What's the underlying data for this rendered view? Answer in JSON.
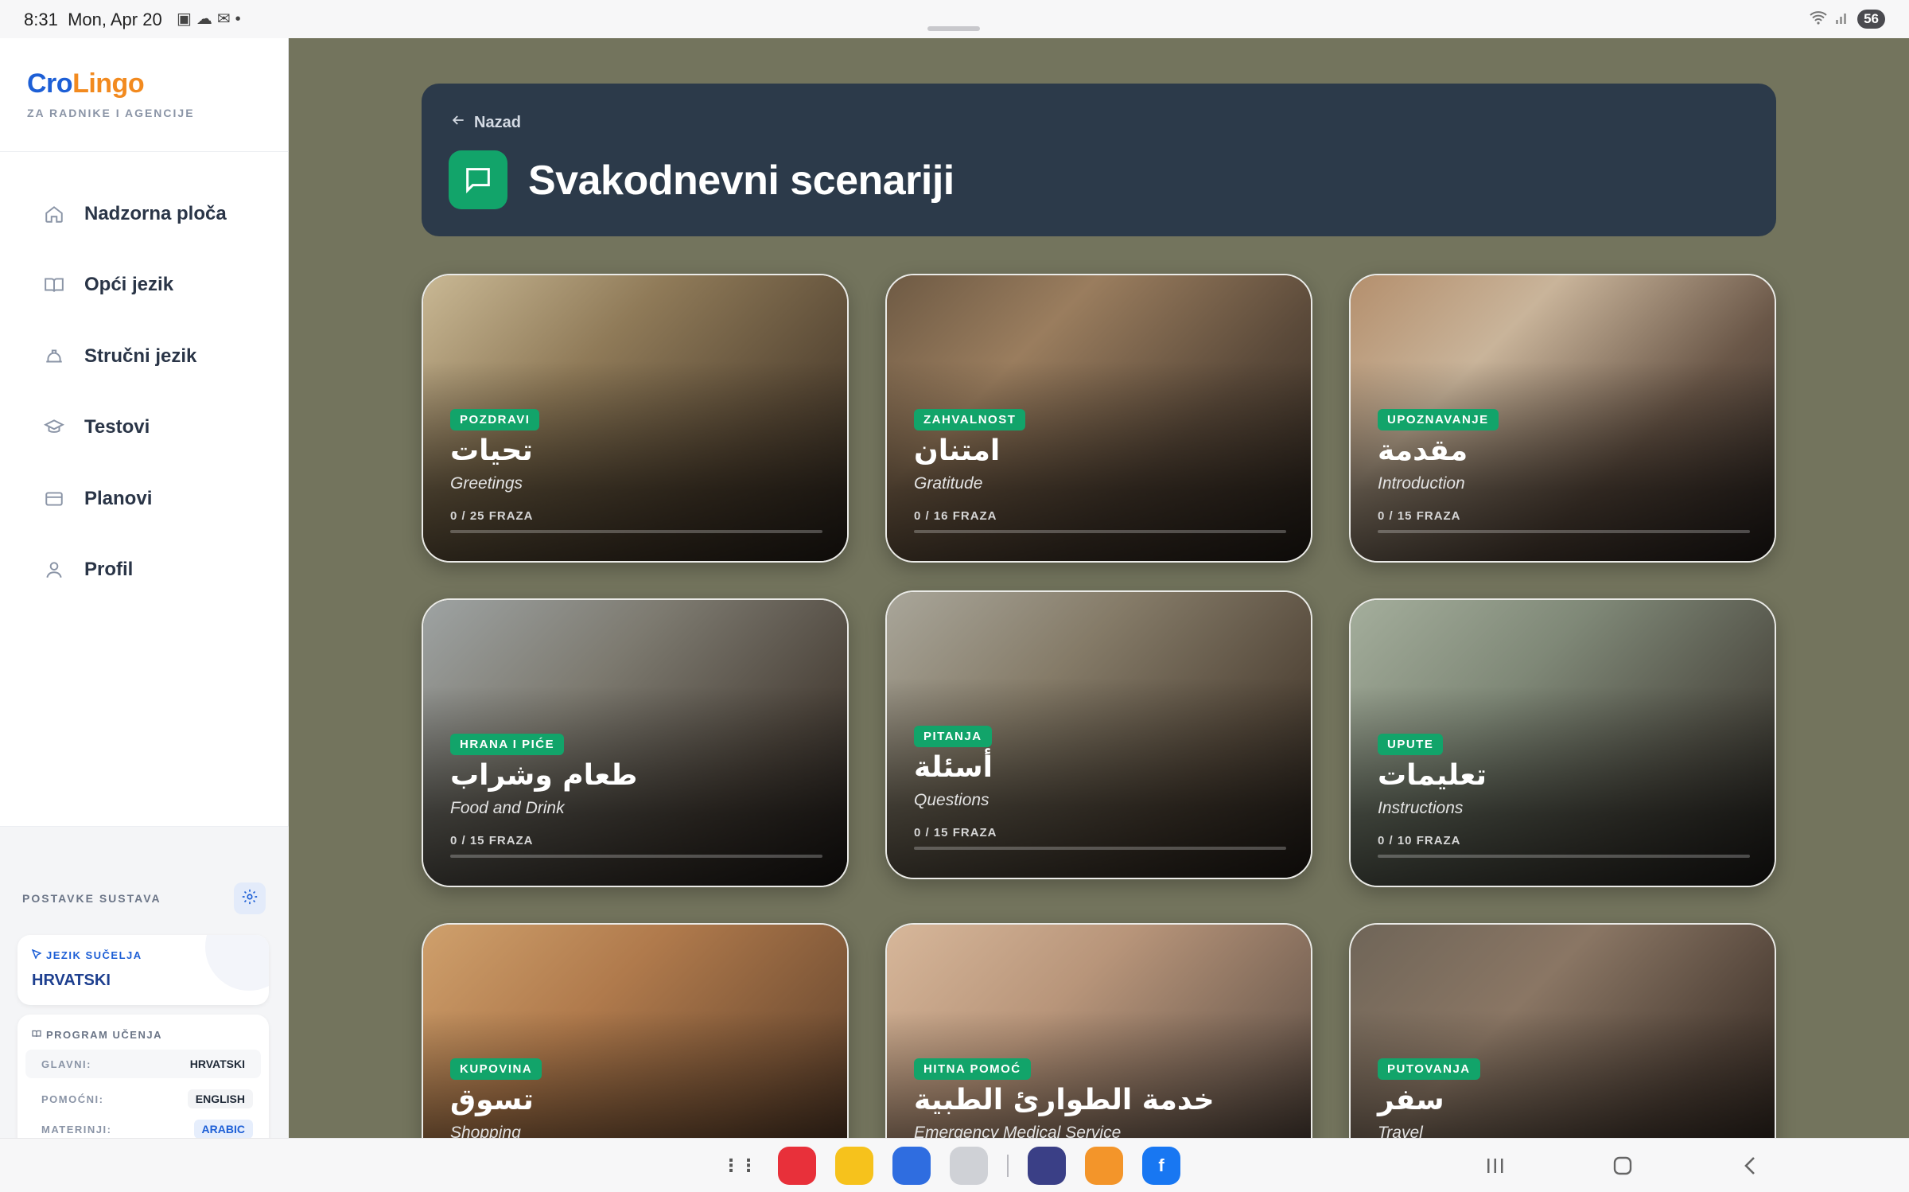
{
  "status_bar": {
    "time": "8:31",
    "date": "Mon, Apr 20",
    "battery": "56"
  },
  "brand": {
    "part1": "Cro",
    "part2": "Lingo",
    "subtitle": "ZA RADNIKE I AGENCIJE"
  },
  "nav": [
    {
      "label": "Nadzorna ploča",
      "icon": "home-icon"
    },
    {
      "label": "Opći jezik",
      "icon": "book-icon"
    },
    {
      "label": "Stručni jezik",
      "icon": "hardhat-icon"
    },
    {
      "label": "Testovi",
      "icon": "graduation-cap-icon"
    },
    {
      "label": "Planovi",
      "icon": "credit-card-icon"
    },
    {
      "label": "Profil",
      "icon": "user-icon"
    }
  ],
  "system": {
    "title": "POSTAVKE SUSTAVA",
    "interface_lang_title": "JEZIK SUČELJA",
    "interface_lang_value": "HRVATSKI",
    "program_title": "PROGRAM UČENJA",
    "rows": [
      {
        "key": "GLAVNI:",
        "value": "HRVATSKI",
        "color": "#1f2937",
        "bg": "#f3f4f6"
      },
      {
        "key": "POMOĆNI:",
        "value": "ENGLISH",
        "color": "#1f2937",
        "bg": "#f3f4f6"
      },
      {
        "key": "MATERINJI:",
        "value": "ARABIC",
        "color": "#1d5fd6",
        "bg": "#e6eefc"
      }
    ]
  },
  "header": {
    "back": "Nazad",
    "title": "Svakodnevni scenariji"
  },
  "cards": [
    {
      "tag": "POZDRAVI",
      "arabic": "تحيات",
      "english": "Greetings",
      "count": "0 / 25 FRAZA",
      "progress": 0,
      "bg": "linear-gradient(135deg,#c9b894 0%,#8f7a58 35%,#5a4a36 70%,#2f271f 100%)"
    },
    {
      "tag": "ZAHVALNOST",
      "arabic": "امتنان",
      "english": "Gratitude",
      "count": "0 / 16 FRAZA",
      "progress": 0,
      "bg": "linear-gradient(135deg,#6e5a44 0%,#9a7d5e 30%,#5b4a3a 65%,#2c241d 100%)"
    },
    {
      "tag": "UPOZNAVANJE",
      "arabic": "مقدمة",
      "english": "Introduction",
      "count": "0 / 15 FRAZA",
      "progress": 0,
      "bg": "linear-gradient(135deg,#b48f6d 0%,#c9b49a 30%,#6a5748 65%,#2a2320 100%)"
    },
    {
      "tag": "HRANA I PIĆE",
      "arabic": "طعام وشراب",
      "english": "Food and Drink",
      "count": "0 / 15 FRAZA",
      "progress": 0,
      "bg": "linear-gradient(135deg,#9ea3a3 0%,#7d7a70 35%,#4e463d 70%,#221d1a 100%)"
    },
    {
      "tag": "PITANJA",
      "arabic": "أسئلة",
      "english": "Questions",
      "count": "0 / 15 FRAZA",
      "progress": 0,
      "bg": "linear-gradient(135deg,#a9a69a 0%,#857b68 35%,#564a3c 70%,#2a231d 100%)"
    },
    {
      "tag": "UPUTE",
      "arabic": "تعليمات",
      "english": "Instructions",
      "count": "0 / 10 FRAZA",
      "progress": 0,
      "bg": "linear-gradient(135deg,#a4ae9c 0%,#7f8877 35%,#504f45 70%,#24221f 100%)"
    },
    {
      "tag": "KUPOVINA",
      "arabic": "تسوق",
      "english": "Shopping",
      "count": "",
      "progress": 0,
      "bg": "linear-gradient(135deg,#cfa06c 0%,#b07a4c 35%,#7a5436 70%,#3d2a1e 100%)"
    },
    {
      "tag": "HITNA POMOĆ",
      "arabic": "خدمة الطوارئ الطبية",
      "english": "Emergency Medical Service",
      "count": "",
      "progress": 0,
      "bg": "linear-gradient(135deg,#d7b79a 0%,#b8957a 35%,#7a6556 70%,#3a302a 100%)"
    },
    {
      "tag": "PUTOVANJA",
      "arabic": "سفر",
      "english": "Travel",
      "count": "",
      "progress": 0,
      "bg": "linear-gradient(135deg,#6f6558 0%,#8a7664 35%,#4e4036 70%,#231c17 100%)"
    }
  ],
  "dock_apps": [
    {
      "name": "app-drawer-icon",
      "label": "⋮⋮",
      "bg": "transparent",
      "color": "#555"
    },
    {
      "name": "notes-app-icon",
      "label": "",
      "bg": "#e8303a",
      "color": "#fff"
    },
    {
      "name": "files-app-icon",
      "label": "",
      "bg": "#f6c21c",
      "color": "#fff"
    },
    {
      "name": "messages-app-icon",
      "label": "",
      "bg": "#2f6de0",
      "color": "#fff"
    },
    {
      "name": "camera-app-icon",
      "label": "",
      "bg": "#cfd1d6",
      "color": "#333"
    },
    {
      "name": "game-app-icon",
      "label": "",
      "bg": "#3a3f86",
      "color": "#fff"
    },
    {
      "name": "tips-app-icon",
      "label": "",
      "bg": "#f3952a",
      "color": "#fff"
    },
    {
      "name": "facebook-app-icon",
      "label": "f",
      "bg": "#1877f2",
      "color": "#fff"
    }
  ]
}
